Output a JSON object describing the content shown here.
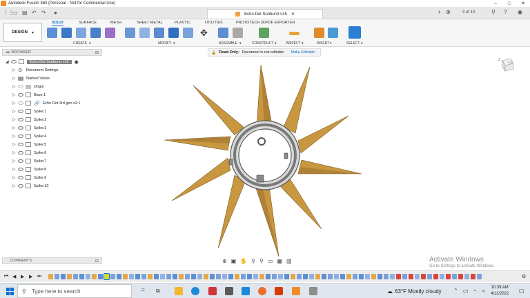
{
  "window": {
    "title": "Autodesk Fusion 360 (Personal - Not for Commercial Use)"
  },
  "tabbar": {
    "document_title": "Echo Dot Sunburst v15",
    "page_counter": "3 of 10"
  },
  "ribbon": {
    "workspace_label": "DESIGN",
    "tabs": [
      "SOLID",
      "SURFACE",
      "MESH",
      "SHEET METAL",
      "PLASTIC",
      "UTILITIES",
      "PROTOTECH 3DPDF EXPORTER"
    ],
    "groups": [
      "CREATE",
      "MODIFY",
      "ASSEMBLE",
      "CONSTRUCT",
      "INSPECT",
      "INSERT",
      "SELECT"
    ],
    "dropdown_glyph": "▾"
  },
  "readonly": {
    "label": "Read-Only:",
    "message": "Document is not editable",
    "action": "Make Editable"
  },
  "browser": {
    "title": "BROWSER",
    "root_label": "Echo Dot Sunburst v15",
    "items": [
      "Document Settings",
      "Named Views",
      "Origin",
      "Base:1",
      "Echo Dot  3rd gen v2:1",
      "Spike:1",
      "Spike:2",
      "Spike:3",
      "Spike:4",
      "Spike:5",
      "Spike:6",
      "Spike:7",
      "Spike:8",
      "Spike:9",
      "Spike:10"
    ]
  },
  "viewcube": {
    "axis_label": "Z",
    "face_label": "TOP"
  },
  "comments": {
    "title": "COMMENTS"
  },
  "watermark": {
    "line1": "Activate Windows",
    "line2": "Go to Settings to activate Windows."
  },
  "taskbar": {
    "search_placeholder": "Type here to search",
    "weather": "63°F  Mostly cloudy",
    "time": "10:39 AM",
    "date": "4/11/2022"
  },
  "colors": {
    "accent": "#0a6fd1",
    "spike": "#c9973f",
    "spike_dark": "#9b7133",
    "ring": "#6e6e6e"
  }
}
